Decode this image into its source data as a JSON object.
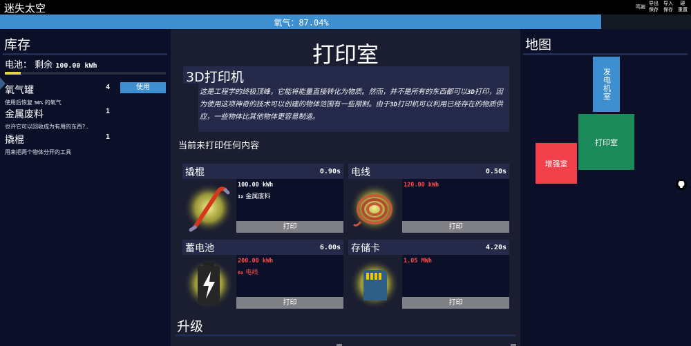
{
  "app": {
    "title": "迷失太空",
    "top_buttons": {
      "credits": "鸣谢",
      "export_save": "导出\n保存",
      "import_save": "导入\n保存",
      "hard_reset": "硬\n重置"
    }
  },
  "oxygen": {
    "label": "氧气：87.04%",
    "percent": 87.04
  },
  "inventory": {
    "title": "库存",
    "battery": {
      "label": "电池：",
      "text": "剩余",
      "value": "100.00 kWh",
      "fill_fraction": 0.1
    },
    "use_label": "使用",
    "items": [
      {
        "name": "氧气罐",
        "count": "4",
        "desc_pre": "使用后恢复",
        "desc_num": "50%",
        "desc_post": "的氧气"
      },
      {
        "name": "金属废料",
        "count": "1",
        "desc": "也许它可以回收成为有用的东西?.."
      },
      {
        "name": "撬棍",
        "count": "1",
        "desc": "用来把两个物体分开的工具"
      }
    ]
  },
  "room": {
    "title": "打印室",
    "printer": {
      "name": "3D打印机",
      "desc_parts": [
        "这是工程学的终极顶峰，它能将能量直接转化为物质。然而，并不是所有的东西都可以",
        "3D",
        "打印，因为使用这项神奇的技术可以创建的物体范围有一些限制。由于",
        "3D",
        "打印机可以利用已经存在的物质供应，一些物体比其他物体更容易制造。"
      ]
    },
    "status": "当前未打印任何内容",
    "print_label": "打印",
    "recipes": [
      {
        "name": "撬棍",
        "time": "0.90s",
        "cost": "100.00 kWh",
        "cost_affordable": true,
        "mat_qty": "1x",
        "mat_name": "金属废料",
        "mat_affordable": true
      },
      {
        "name": "电线",
        "time": "0.50s",
        "cost": "120.00 kWh",
        "cost_affordable": false,
        "mat_qty": "",
        "mat_name": "",
        "mat_affordable": true
      },
      {
        "name": "蓄电池",
        "time": "6.00s",
        "cost": "200.00 kWh",
        "cost_affordable": false,
        "mat_qty": "6x",
        "mat_name": "电线",
        "mat_affordable": false
      },
      {
        "name": "存储卡",
        "time": "4.20s",
        "cost": "1.05 MWh",
        "cost_affordable": false,
        "mat_qty": "",
        "mat_name": "",
        "mat_affordable": true
      }
    ],
    "upgrades_title": "升级"
  },
  "map": {
    "title": "地图",
    "rooms": {
      "generator": "发电机室",
      "printer": "打印室",
      "enhance": "增强室"
    }
  },
  "colors": {
    "accent_blue": "#3e8fd0",
    "printer_room_green": "#1b8a5a",
    "enhance_room_red": "#f2404a",
    "insufficient_red": "#ff4a4a",
    "battery_yellow": "#e6d64a"
  },
  "icons": {
    "crowbar": "crowbar-icon",
    "wire": "wire-coil-icon",
    "battery": "battery-icon",
    "memory_card": "memory-card-icon",
    "github": "github-icon"
  }
}
